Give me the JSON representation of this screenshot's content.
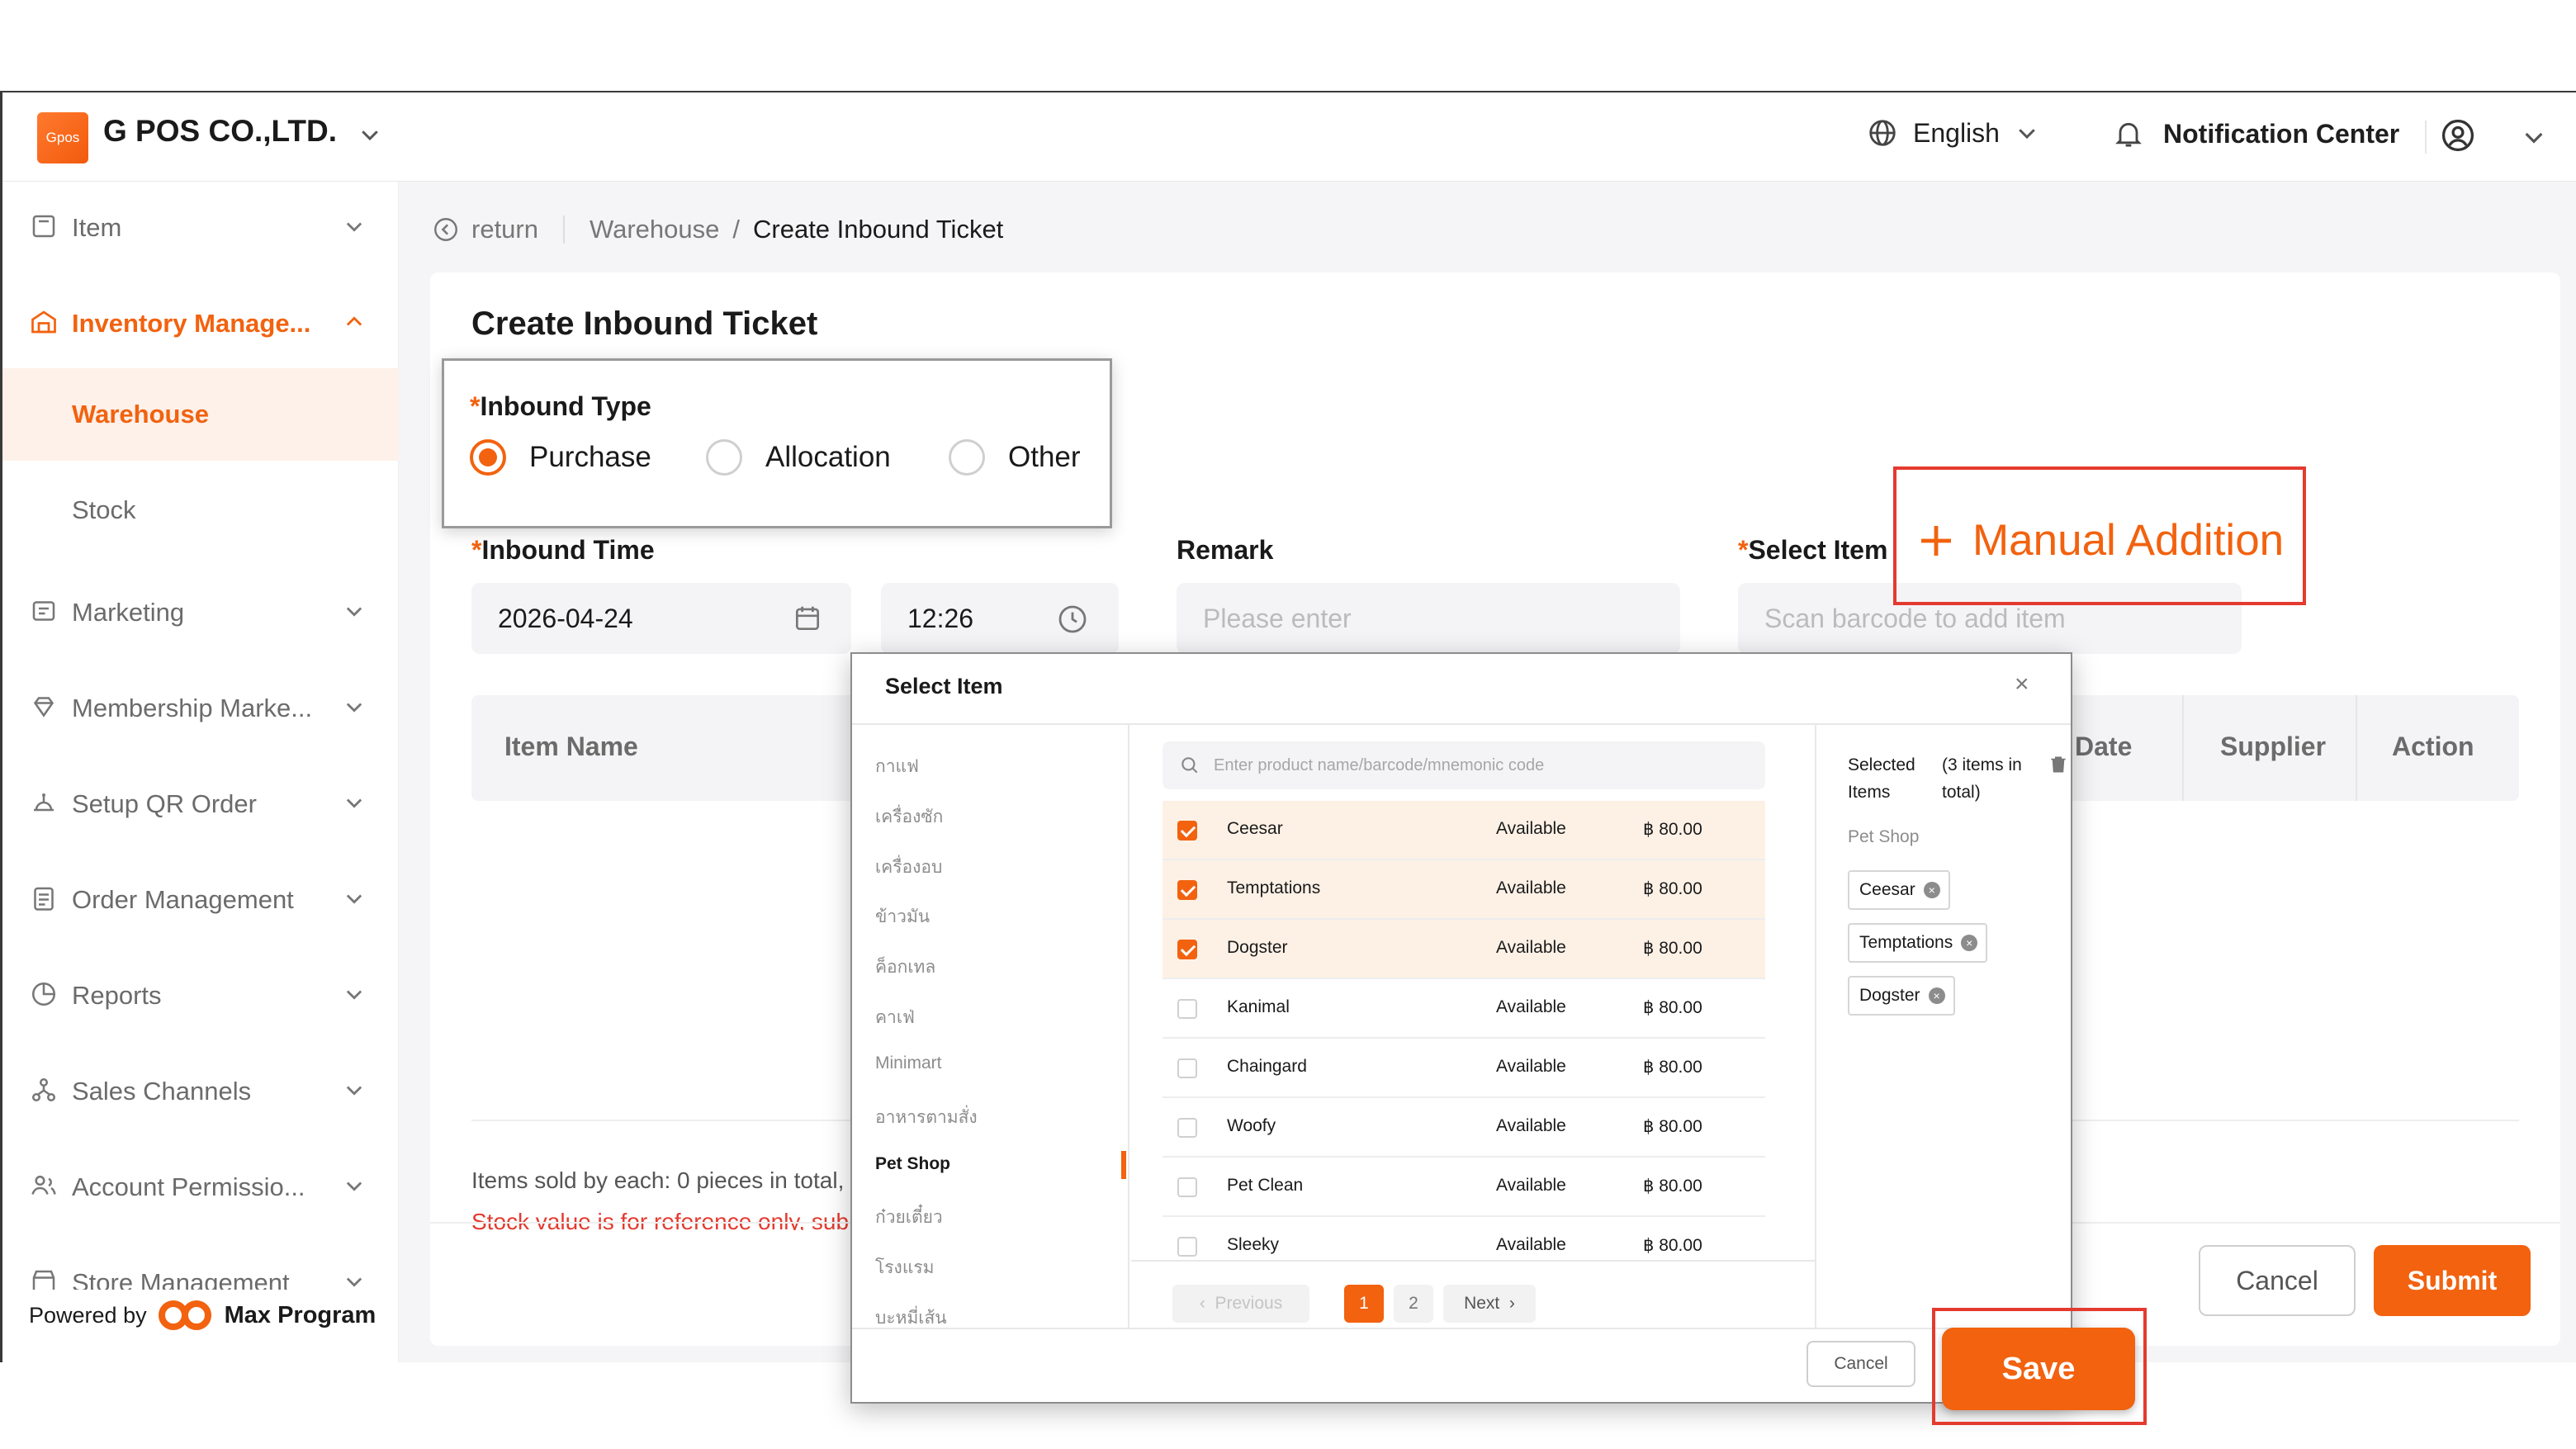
{
  "header": {
    "logo_text": "Gpos",
    "company": "G POS CO.,LTD.",
    "language": "English",
    "notification": "Notification Center"
  },
  "sidebar": {
    "items": [
      {
        "label": "Item",
        "icon": "item-icon"
      },
      {
        "label": "Inventory Manage...",
        "icon": "inventory-icon",
        "active": true
      },
      {
        "label": "Marketing",
        "icon": "marketing-icon"
      },
      {
        "label": "Membership Marke...",
        "icon": "membership-icon"
      },
      {
        "label": "Setup QR Order",
        "icon": "qr-order-icon"
      },
      {
        "label": "Order Management",
        "icon": "order-icon"
      },
      {
        "label": "Reports",
        "icon": "reports-icon"
      },
      {
        "label": "Sales Channels",
        "icon": "sales-channels-icon"
      },
      {
        "label": "Account Permissio...",
        "icon": "account-icon"
      },
      {
        "label": "Store Management",
        "icon": "store-icon"
      }
    ],
    "sub_items": [
      "Warehouse",
      "Stock"
    ],
    "powered_by": "Powered by",
    "powered_brand": "Max Program"
  },
  "breadcrumb": {
    "return": "return",
    "parent": "Warehouse",
    "separator": "/",
    "current": "Create Inbound Ticket"
  },
  "form": {
    "title": "Create Inbound Ticket",
    "inbound_type_label": "Inbound Type",
    "inbound_options": [
      "Purchase",
      "Allocation",
      "Other"
    ],
    "inbound_selected": "Purchase",
    "inbound_time_label": "Inbound Time",
    "date": "2026-04-24",
    "time": "12:26",
    "remark_label": "Remark",
    "remark_placeholder": "Please enter",
    "select_item_label": "Select Item",
    "scan_placeholder": "Scan barcode to add item",
    "manual_addition": "Manual Addition"
  },
  "table": {
    "headers": [
      "Item Name",
      "Date",
      "Supplier",
      "Action"
    ]
  },
  "notes": {
    "line1": "Items sold by each: 0 pieces in total,",
    "line2": "Stock value is for reference only, sub"
  },
  "footer": {
    "cancel": "Cancel",
    "submit": "Submit"
  },
  "modal": {
    "title": "Select Item",
    "close": "×",
    "categories": [
      "กาแฟ",
      "เครื่องซัก",
      "เครื่องอบ",
      "ข้าวมัน",
      "ค็อกเทล",
      "คาเฟ่",
      "Minimart",
      "อาหารตามสั่ง",
      "Pet Shop",
      "ก๋วยเตี๋ยว",
      "โรงแรม",
      "บะหมี่เส้น"
    ],
    "active_category": "Pet Shop",
    "search_placeholder": "Enter product name/barcode/mnemonic code",
    "items": [
      {
        "name": "Ceesar",
        "status": "Available",
        "price": "฿ 80.00",
        "checked": true
      },
      {
        "name": "Temptations",
        "status": "Available",
        "price": "฿ 80.00",
        "checked": true
      },
      {
        "name": "Dogster",
        "status": "Available",
        "price": "฿ 80.00",
        "checked": true
      },
      {
        "name": "Kanimal",
        "status": "Available",
        "price": "฿ 80.00",
        "checked": false
      },
      {
        "name": "Chaingard",
        "status": "Available",
        "price": "฿ 80.00",
        "checked": false
      },
      {
        "name": "Woofy",
        "status": "Available",
        "price": "฿ 80.00",
        "checked": false
      },
      {
        "name": "Pet Clean",
        "status": "Available",
        "price": "฿ 80.00",
        "checked": false
      },
      {
        "name": "Sleeky",
        "status": "Available",
        "price": "฿ 80.00",
        "checked": false
      }
    ],
    "pagination": {
      "previous": "Previous",
      "pages": [
        "1",
        "2"
      ],
      "current": "1",
      "next": "Next"
    },
    "selected_title": "Selected Items",
    "selected_count": "(3 items in total)",
    "selected_group": "Pet Shop",
    "selected_tags": [
      "Ceesar",
      "Temptations",
      "Dogster"
    ],
    "cancel": "Cancel",
    "save": "Save"
  },
  "colors": {
    "accent": "#f2620f",
    "highlight_box": "#e43a2f",
    "selected_row": "#fdf1e6"
  }
}
